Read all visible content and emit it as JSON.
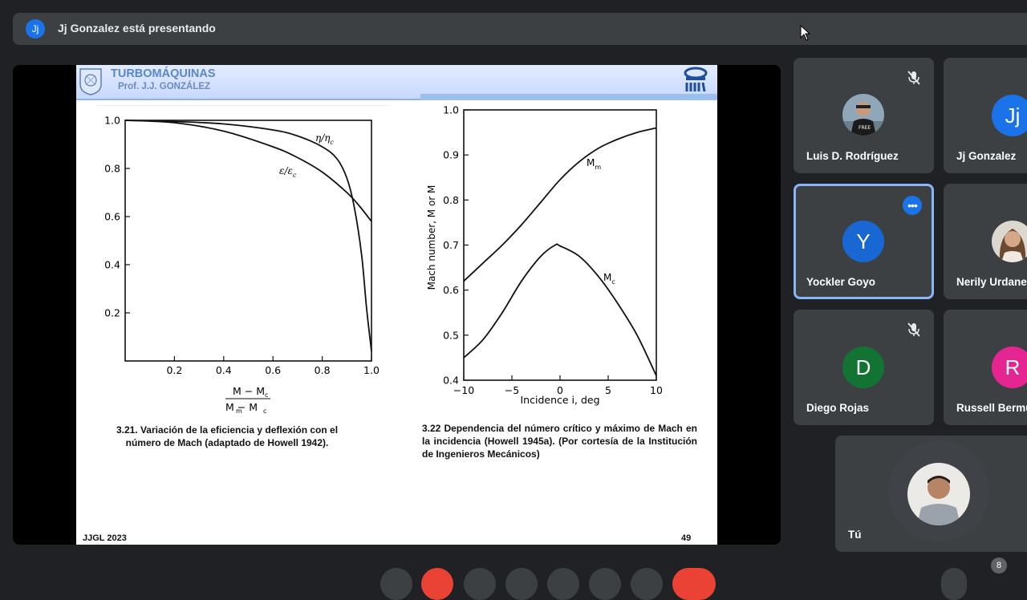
{
  "banner": {
    "avatar": "Jj",
    "text": "Jj Gonzalez está presentando"
  },
  "slide": {
    "title": "TURBOMÁQUINAS",
    "subtitle": "Prof. J.J. GONZÁLEZ",
    "footer_left": "JJGL 2023",
    "page": "49",
    "caption_left": "3.21. Variación de la eficiencia y deflexión con el número de Mach (adaptado de Howell 1942).",
    "caption_right": "3.22 Dependencia del número crítico y máximo de Mach en la incidencia (Howell 1945a). (Por cortesía de la Institución de Ingenieros Mecánicos)"
  },
  "chart_data": [
    {
      "type": "line",
      "xlabel_top": "M − M",
      "xlabel_bottom": "M   − M",
      "xlim": [
        0,
        1.0
      ],
      "ylim": [
        0,
        1.0
      ],
      "xticks": [
        "0.2",
        "0.4",
        "0.6",
        "0.8",
        "1.0"
      ],
      "yticks": [
        "0.2",
        "0.4",
        "0.6",
        "0.8",
        "1.0"
      ],
      "series": [
        {
          "name": "η/η",
          "x": [
            0,
            0.2,
            0.4,
            0.6,
            0.7,
            0.8,
            0.86,
            0.9,
            0.93,
            0.96,
            0.98,
            1.0
          ],
          "y": [
            1.0,
            0.995,
            0.985,
            0.96,
            0.935,
            0.89,
            0.84,
            0.76,
            0.64,
            0.44,
            0.22,
            0.04
          ]
        },
        {
          "name": "ε/ε",
          "x": [
            0,
            0.2,
            0.4,
            0.6,
            0.7,
            0.8,
            0.9,
            0.95,
            1.0
          ],
          "y": [
            1.0,
            0.99,
            0.955,
            0.89,
            0.845,
            0.785,
            0.7,
            0.645,
            0.58
          ]
        }
      ]
    },
    {
      "type": "line",
      "xlabel": "Incidence i, deg",
      "ylabel": "Mach number, M  or M",
      "xlim": [
        -10,
        10
      ],
      "ylim": [
        0.4,
        1.0
      ],
      "xticks": [
        "−10",
        "−5",
        "0",
        "5",
        "10"
      ],
      "yticks": [
        "0.4",
        "0.5",
        "0.6",
        "0.7",
        "0.8",
        "0.9",
        "1.0"
      ],
      "series": [
        {
          "name": "M",
          "x": [
            -10,
            -8,
            -6,
            -4,
            -2,
            0,
            2,
            4,
            6,
            8,
            10
          ],
          "y": [
            0.62,
            0.66,
            0.7,
            0.745,
            0.795,
            0.845,
            0.885,
            0.915,
            0.935,
            0.95,
            0.96
          ]
        },
        {
          "name": "M",
          "x": [
            -10,
            -8,
            -6,
            -4,
            -2,
            -0.5,
            0,
            2,
            4,
            6,
            8,
            10
          ],
          "y": [
            0.45,
            0.49,
            0.55,
            0.62,
            0.675,
            0.7,
            0.698,
            0.675,
            0.63,
            0.57,
            0.5,
            0.41
          ]
        }
      ]
    }
  ],
  "participants": [
    {
      "name": "Luis D. Rodríguez",
      "muted": true
    },
    {
      "name": "Jj Gonzalez",
      "initial": "Jj",
      "color": "#1a73e8"
    },
    {
      "name": "Yockler Goyo",
      "initial": "Y",
      "color": "#1967d2"
    },
    {
      "name": "Nerily Urdaneta"
    },
    {
      "name": "Diego Rojas",
      "initial": "D",
      "color": "#137333",
      "muted": true
    },
    {
      "name": "Russell Bermudez",
      "initial": "R",
      "color": "#e52592"
    },
    {
      "name": "Tú"
    }
  ],
  "participant_count": "8"
}
